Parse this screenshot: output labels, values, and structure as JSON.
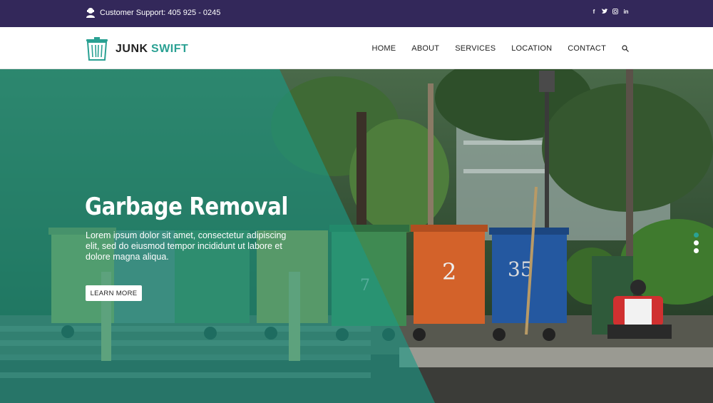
{
  "topbar": {
    "support_text": "Customer Support: 405 925 - 0245",
    "social": [
      "facebook-icon",
      "twitter-icon",
      "instagram-icon",
      "linkedin-icon"
    ]
  },
  "brand": {
    "word1": "JUNK",
    "word2": "SWIFT",
    "accent": "#2aa193",
    "topbar_bg": "#33285a"
  },
  "nav": {
    "items": [
      "HOME",
      "ABOUT",
      "SERVICES",
      "LOCATION",
      "CONTACT"
    ]
  },
  "hero": {
    "title": "Garbage Removal",
    "description": "Lorem ipsum dolor sit amet, consectetur adipiscing elit, sed do eiusmod tempor incididunt ut labore et dolore magna aliqua.",
    "button": "LEARN MORE",
    "bin_numbers": [
      "7",
      "2",
      "35"
    ],
    "slides": 3,
    "active_slide": 1
  }
}
